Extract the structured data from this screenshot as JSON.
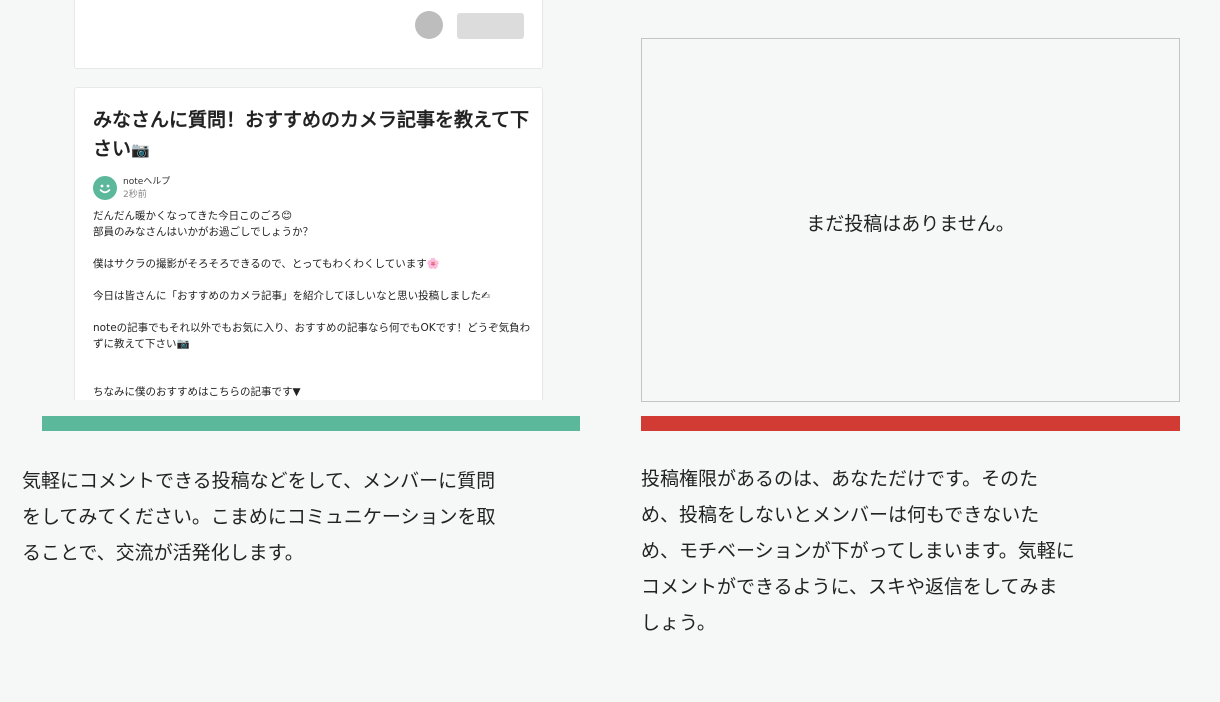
{
  "left": {
    "post": {
      "title": "みなさんに質問！おすすめのカメラ記事を教えて下さい",
      "title_emoji": "📷",
      "author": "noteヘルプ",
      "time": "2秒前",
      "body": {
        "line1": "だんだん暖かくなってきた今日このごろ😊",
        "line2": "部員のみなさんはいかがお過ごしでしょうか？",
        "line3": "僕はサクラの撮影がそろそろできるので、とってもわくわくしています🌸",
        "line4": "今日は皆さんに「おすすめのカメラ記事」を紹介してほしいなと思い投稿しました✍",
        "line5": "noteの記事でもそれ以外でもお気に入り、おすすめの記事なら何でもOKです！どうぞ気負わずに教えて下さい📷",
        "line6": "ちなみに僕のおすすめはこちらの記事です▼"
      }
    },
    "bar_color": "#5cb89a",
    "description": {
      "line1": "気軽にコメントできる投稿などをして、メンバーに質問",
      "line2": "をしてみてください。こまめにコミュニケーションを取",
      "line3": "ることで、交流が活発化します。"
    }
  },
  "right": {
    "empty_message": "まだ投稿はありません。",
    "bar_color": "#d23b33",
    "description": {
      "line1": "投稿権限があるのは、あなただけです。そのた",
      "line2": "め、投稿をしないとメンバーは何もできないた",
      "line3": "め、モチベーションが下がってしまいます。気軽に",
      "line4": "コメントができるように、スキや返信をしてみま",
      "line5": "しょう。"
    }
  }
}
